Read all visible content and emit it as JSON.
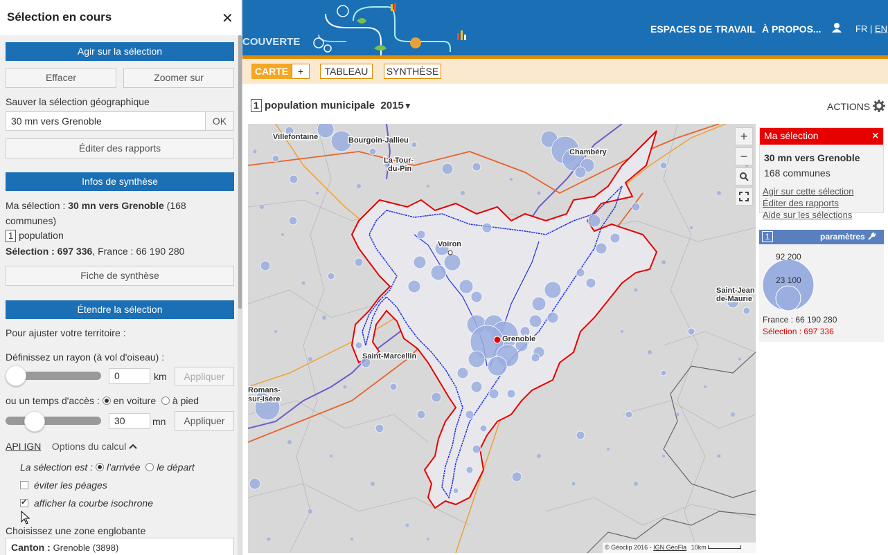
{
  "left_panel": {
    "title": "Sélection en cours",
    "close": "✕",
    "act_header": "Agir sur la sélection",
    "clear_btn": "Effacer",
    "zoom_btn": "Zoomer sur",
    "save_label": "Sauver la sélection géographique",
    "save_value": "30 mn vers Grenoble",
    "ok_btn": "OK",
    "reports_btn": "Éditer des rapports",
    "summary_header": "Infos de synthèse",
    "summary_prefix": "Ma sélection : ",
    "summary_name": "30 mn vers Grenoble",
    "summary_suffix": " (168",
    "summary_line2": "communes)",
    "summary_indicator_num": "1",
    "summary_indicator": "population",
    "summary_sel_label": "Sélection : 697 336",
    "summary_france": ", France : 66 190 280",
    "sheet_btn": "Fiche de synthèse",
    "extend_header": "Étendre la sélection",
    "adjust_label": "Pour ajuster votre territoire :",
    "radius_label": "Définissez un rayon (à vol d'oiseau) :",
    "radius_value": "0",
    "radius_unit": "km",
    "radius_apply": "Appliquer",
    "radius_level": 0,
    "time_label": "ou un temps d'accès :",
    "car_label": "en voiture",
    "foot_label": "à pied",
    "time_value": "30",
    "time_unit": "mn",
    "time_apply": "Appliquer",
    "time_level": 0.25,
    "api_link": "API IGN",
    "options_label": "Options du calcul",
    "sel_is_label": "La sélection est :",
    "arrival_label": "l'arrivée",
    "departure_label": "le départ",
    "tolls_label": "éviter les péages",
    "isochrone_label": "afficher la courbe isochrone",
    "zone_label": "Choisissez une zone englobante",
    "zone_type": "Canton :",
    "zone_value": "Grenoble (3898)"
  },
  "header": {
    "brand_fragment": "COUVERTE",
    "nav_workspaces": "ESPACES DE TRAVAIL",
    "nav_about": "À PROPOS...",
    "lang_fr": "FR",
    "lang_sep": "|",
    "lang_en": "EN"
  },
  "tabs": {
    "map": "CARTE",
    "plus": "+",
    "table": "TABLEAU",
    "synthesis": "SYNTHÈSE"
  },
  "indicator": {
    "num": "1",
    "label": "population municipale",
    "year": "2015",
    "caret": "▼",
    "actions": "ACTIONS"
  },
  "map": {
    "zoom_in": "+",
    "zoom_out": "−",
    "cities": {
      "villefontaine": "Villefontaine",
      "bourgoin": "Bourgoin-Jallieu",
      "latour1": "La Tour-",
      "latour2": "du-Pin",
      "chambery": "Chambéry",
      "voiron": "Voiron",
      "grenoble": "Grenoble",
      "saintmarcellin": "Saint-Marcellin",
      "romans1": "Romans-",
      "romans2": "sur-Isère",
      "saintjean1": "Saint-Jean",
      "saintjean2": "de-Maurie"
    },
    "attribution_copy": "© Géoclip 2016 - ",
    "attribution_link": "IGN GéoFla",
    "scale_label": "10km"
  },
  "selection_box": {
    "title": "Ma sélection",
    "close": "✕",
    "name": "30 mn vers Grenoble",
    "count": "168 communes",
    "link_act": "Agir sur cette sélection",
    "link_reports": "Éditer des rapports",
    "link_help": "Aide sur les sélections"
  },
  "legend": {
    "num": "1",
    "params": "paramètres",
    "big_value": "92 200",
    "small_value": "23 100",
    "france": "France : 66 190 280",
    "selection": "Sélection : 697 336"
  },
  "colors": {
    "brand_blue": "#1a6fb5",
    "accent_orange": "#e08a00",
    "selection_red": "#e60000",
    "param_blue": "#5a7fbf"
  }
}
